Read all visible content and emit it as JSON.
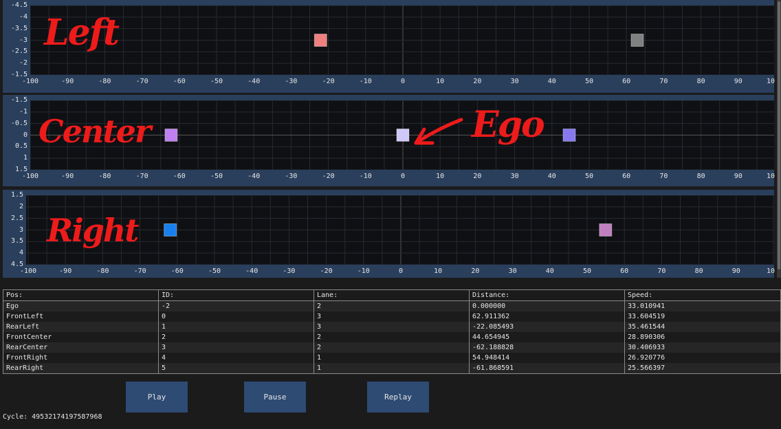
{
  "lane_plots": [
    {
      "name": "left",
      "annotation": "Left",
      "yticks": [
        "-4.5",
        "-4",
        "-3.5",
        "-3",
        "-2.5",
        "-2",
        "-1.5"
      ],
      "ylim": [
        -4.5,
        -1.5
      ],
      "markers": [
        {
          "x": -22.085493,
          "y": -3,
          "color": "#f08080"
        },
        {
          "x": 62.911362,
          "y": -3,
          "color": "#808080"
        }
      ]
    },
    {
      "name": "center",
      "annotation": "Center",
      "yticks": [
        "-1.5",
        "-1",
        "-0.5",
        "0",
        "0.5",
        "1",
        "1.5"
      ],
      "ylim": [
        -1.5,
        1.5
      ],
      "markers": [
        {
          "x": -62.188828,
          "y": 0,
          "color": "#c080f0"
        },
        {
          "x": 0.0,
          "y": 0,
          "color": "#d0c8f8"
        },
        {
          "x": 44.654945,
          "y": 0,
          "color": "#8878f0"
        }
      ],
      "extra_label": "Ego"
    },
    {
      "name": "right",
      "annotation": "Right",
      "yticks": [
        "1.5",
        "2",
        "2.5",
        "3",
        "3.5",
        "4",
        "4.5"
      ],
      "ylim": [
        1.5,
        4.5
      ],
      "markers": [
        {
          "x": -61.868591,
          "y": 3,
          "color": "#1880ee"
        },
        {
          "x": 54.948414,
          "y": 3,
          "color": "#c080c0"
        }
      ]
    }
  ],
  "xticks": [
    "-100",
    "-90",
    "-80",
    "-70",
    "-60",
    "-50",
    "-40",
    "-30",
    "-20",
    "-10",
    "0",
    "10",
    "20",
    "30",
    "40",
    "50",
    "60",
    "70",
    "80",
    "90",
    "10"
  ],
  "xlim": [
    -100,
    100
  ],
  "table": {
    "headers": [
      "Pos:",
      "ID:",
      "Lane:",
      "Distance:",
      "Speed:"
    ],
    "rows": [
      [
        "Ego",
        "-2",
        "2",
        "0.000000",
        "33.010941"
      ],
      [
        "FrontLeft",
        "0",
        "3",
        "62.911362",
        "33.604519"
      ],
      [
        "RearLeft",
        "1",
        "3",
        "-22.085493",
        "35.461544"
      ],
      [
        "FrontCenter",
        "2",
        "2",
        "44.654945",
        "28.890306"
      ],
      [
        "RearCenter",
        "3",
        "2",
        "-62.188828",
        "30.406933"
      ],
      [
        "FrontRight",
        "4",
        "1",
        "54.948414",
        "26.920776"
      ],
      [
        "RearRight",
        "5",
        "1",
        "-61.868591",
        "25.566397"
      ]
    ]
  },
  "buttons": {
    "play": "Play",
    "pause": "Pause",
    "replay": "Replay"
  },
  "cycle": "Cycle: 49532174197587968"
}
